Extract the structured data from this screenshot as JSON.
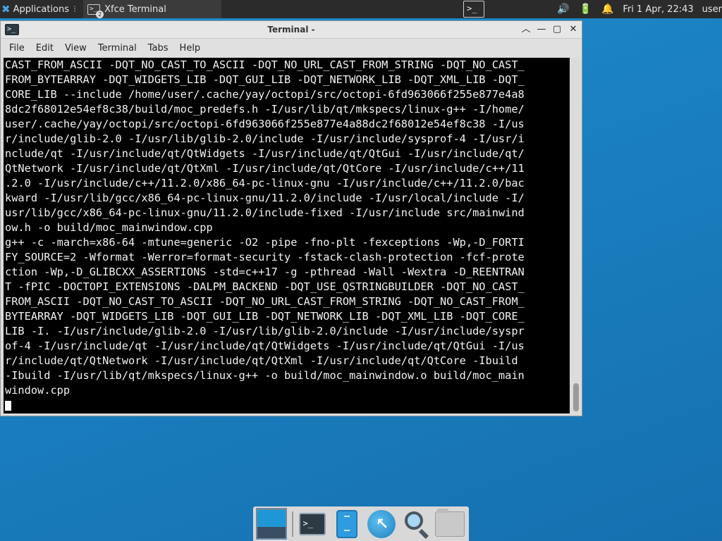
{
  "top_panel": {
    "applications_label": "Applications",
    "task_title": "Xfce Terminal",
    "task_badge": "2",
    "tray": {
      "volume_icon": "volume-icon",
      "power_icon": "battery-icon",
      "notification_icon": "bell-icon"
    },
    "clock": "Fri  1 Apr, 22:43",
    "user": "user"
  },
  "window": {
    "title": "Terminal -",
    "menu": [
      "File",
      "Edit",
      "View",
      "Terminal",
      "Tabs",
      "Help"
    ],
    "terminal_lines": [
      "CAST_FROM_ASCII -DQT_NO_CAST_TO_ASCII -DQT_NO_URL_CAST_FROM_STRING -DQT_NO_CAST_",
      "FROM_BYTEARRAY -DQT_WIDGETS_LIB -DQT_GUI_LIB -DQT_NETWORK_LIB -DQT_XML_LIB -DQT_",
      "CORE_LIB --include /home/user/.cache/yay/octopi/src/octopi-6fd963066f255e877e4a8",
      "8dc2f68012e54ef8c38/build/moc_predefs.h -I/usr/lib/qt/mkspecs/linux-g++ -I/home/",
      "user/.cache/yay/octopi/src/octopi-6fd963066f255e877e4a88dc2f68012e54ef8c38 -I/us",
      "r/include/glib-2.0 -I/usr/lib/glib-2.0/include -I/usr/include/sysprof-4 -I/usr/i",
      "nclude/qt -I/usr/include/qt/QtWidgets -I/usr/include/qt/QtGui -I/usr/include/qt/",
      "QtNetwork -I/usr/include/qt/QtXml -I/usr/include/qt/QtCore -I/usr/include/c++/11",
      ".2.0 -I/usr/include/c++/11.2.0/x86_64-pc-linux-gnu -I/usr/include/c++/11.2.0/bac",
      "kward -I/usr/lib/gcc/x86_64-pc-linux-gnu/11.2.0/include -I/usr/local/include -I/",
      "usr/lib/gcc/x86_64-pc-linux-gnu/11.2.0/include-fixed -I/usr/include src/mainwind",
      "ow.h -o build/moc_mainwindow.cpp",
      "g++ -c -march=x86-64 -mtune=generic -O2 -pipe -fno-plt -fexceptions -Wp,-D_FORTI",
      "FY_SOURCE=2 -Wformat -Werror=format-security -fstack-clash-protection -fcf-prote",
      "ction -Wp,-D_GLIBCXX_ASSERTIONS -std=c++17 -g -pthread -Wall -Wextra -D_REENTRAN",
      "T -fPIC -DOCTOPI_EXTENSIONS -DALPM_BACKEND -DQT_USE_QSTRINGBUILDER -DQT_NO_CAST_",
      "FROM_ASCII -DQT_NO_CAST_TO_ASCII -DQT_NO_URL_CAST_FROM_STRING -DQT_NO_CAST_FROM_",
      "BYTEARRAY -DQT_WIDGETS_LIB -DQT_GUI_LIB -DQT_NETWORK_LIB -DQT_XML_LIB -DQT_CORE_",
      "LIB -I. -I/usr/include/glib-2.0 -I/usr/lib/glib-2.0/include -I/usr/include/syspr",
      "of-4 -I/usr/include/qt -I/usr/include/qt/QtWidgets -I/usr/include/qt/QtGui -I/us",
      "r/include/qt/QtNetwork -I/usr/include/qt/QtXml -I/usr/include/qt/QtCore -Ibuild ",
      "-Ibuild -I/usr/lib/qt/mkspecs/linux-g++ -o build/moc_mainwindow.o build/moc_main",
      "window.cpp"
    ]
  },
  "dock": {
    "items": [
      "show-desktop-icon",
      "terminal-icon",
      "phone-icon",
      "web-browser-icon",
      "app-finder-icon",
      "file-manager-icon"
    ]
  }
}
